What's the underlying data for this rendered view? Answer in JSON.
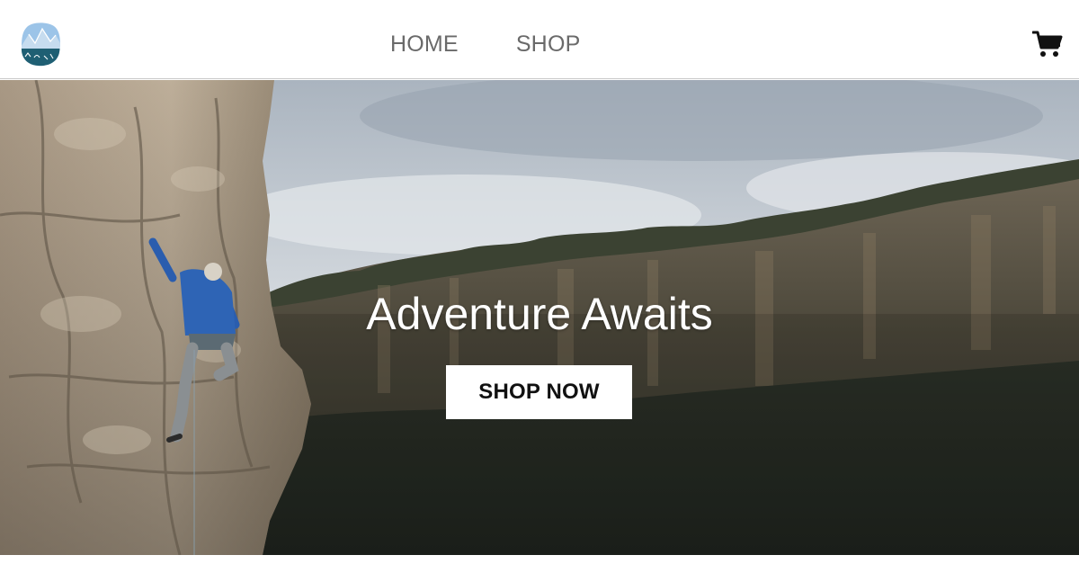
{
  "header": {
    "logo_icon": "mountain-logo-icon",
    "nav": [
      {
        "label": "HOME"
      },
      {
        "label": "SHOP"
      }
    ],
    "cart_icon": "shopping-cart-icon"
  },
  "hero": {
    "title": "Adventure Awaits",
    "cta_label": "SHOP NOW",
    "background_image": "climber-on-cliff-canyon-photo"
  },
  "colors": {
    "nav_text": "#6a6a6a",
    "logo_sky": "#9cc4e8",
    "logo_ground": "#1f5f73",
    "hero_title": "#ffffff",
    "cta_background": "#ffffff",
    "cta_text": "#111111"
  }
}
